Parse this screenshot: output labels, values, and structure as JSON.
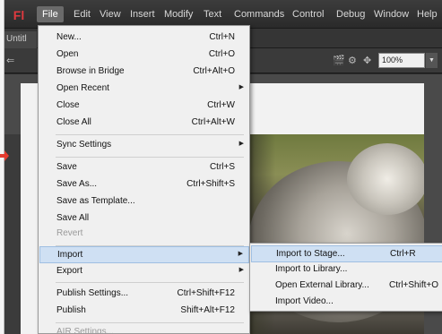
{
  "app": {
    "logo": "Fl"
  },
  "menubar": {
    "items": [
      {
        "label": "File",
        "active": true
      },
      {
        "label": "Edit"
      },
      {
        "label": "View"
      },
      {
        "label": "Insert"
      },
      {
        "label": "Modify"
      },
      {
        "label": "Text"
      },
      {
        "label": "Commands"
      },
      {
        "label": "Control"
      },
      {
        "label": "Debug"
      },
      {
        "label": "Window"
      },
      {
        "label": "Help"
      }
    ]
  },
  "doc_tab": {
    "label": "Untitl"
  },
  "edit_bar": {
    "zoom": "100%"
  },
  "file_menu": {
    "items": [
      {
        "label": "New...",
        "shortcut": "Ctrl+N"
      },
      {
        "label": "Open",
        "shortcut": "Ctrl+O"
      },
      {
        "label": "Browse in Bridge",
        "shortcut": "Ctrl+Alt+O"
      },
      {
        "label": "Open Recent",
        "shortcut": ""
      },
      {
        "label": "Close",
        "shortcut": "Ctrl+W"
      },
      {
        "label": "Close All",
        "shortcut": "Ctrl+Alt+W"
      },
      {
        "label": "Sync Settings",
        "shortcut": ""
      },
      {
        "label": "Save",
        "shortcut": "Ctrl+S"
      },
      {
        "label": "Save As...",
        "shortcut": "Ctrl+Shift+S"
      },
      {
        "label": "Save as Template...",
        "shortcut": ""
      },
      {
        "label": "Save All",
        "shortcut": ""
      },
      {
        "label": "Revert",
        "shortcut": ""
      },
      {
        "label": "Import",
        "shortcut": ""
      },
      {
        "label": "Export",
        "shortcut": ""
      },
      {
        "label": "Publish Settings...",
        "shortcut": "Ctrl+Shift+F12"
      },
      {
        "label": "Publish",
        "shortcut": "Shift+Alt+F12"
      },
      {
        "label": "AIR Settings...",
        "shortcut": ""
      }
    ]
  },
  "import_submenu": {
    "items": [
      {
        "label": "Import to Stage...",
        "shortcut": "Ctrl+R"
      },
      {
        "label": "Import to Library...",
        "shortcut": ""
      },
      {
        "label": "Open External Library...",
        "shortcut": "Ctrl+Shift+O"
      },
      {
        "label": "Import Video...",
        "shortcut": ""
      }
    ]
  },
  "colors": {
    "menubar_bg": "#2f2f2f",
    "menu_bg": "#f0f0f0",
    "highlight": "#cfe0f3",
    "logo_red": "#e0393f",
    "pointer_red": "#e53a2e"
  }
}
